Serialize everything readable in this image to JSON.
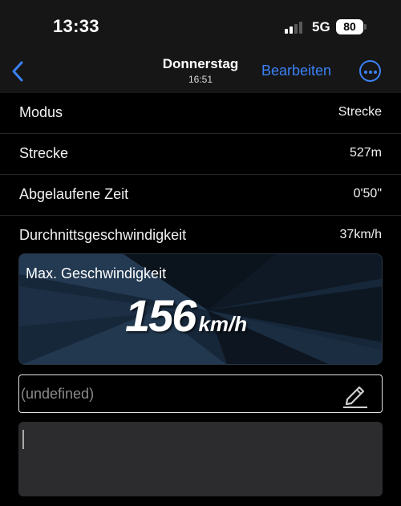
{
  "status_bar": {
    "time": "13:33",
    "network": "5G",
    "battery": "80"
  },
  "nav": {
    "title": "Donnerstag",
    "subtitle": "16:51",
    "edit_label": "Bearbeiten"
  },
  "details": [
    {
      "label": "Modus",
      "value": "Strecke"
    },
    {
      "label": "Strecke",
      "value": "527m"
    },
    {
      "label": "Abgelaufene Zeit",
      "value": "0'50\""
    },
    {
      "label": "Durchnittsgeschwindigkeit",
      "value": "37km/h"
    }
  ],
  "max_speed": {
    "label": "Max. Geschwindigkeit",
    "value": "156",
    "unit": "km/h"
  },
  "title_field": {
    "placeholder": "(undefined)"
  },
  "colors": {
    "accent": "#3b82f6",
    "background": "#000000",
    "card_background": "#162231",
    "note_background": "#2c2c2e"
  },
  "icons": {
    "back": "chevron-left-icon",
    "more": "ellipsis-circle-icon",
    "edit": "pencil-icon",
    "signal": "cellular-signal-icon",
    "battery": "battery-icon"
  }
}
